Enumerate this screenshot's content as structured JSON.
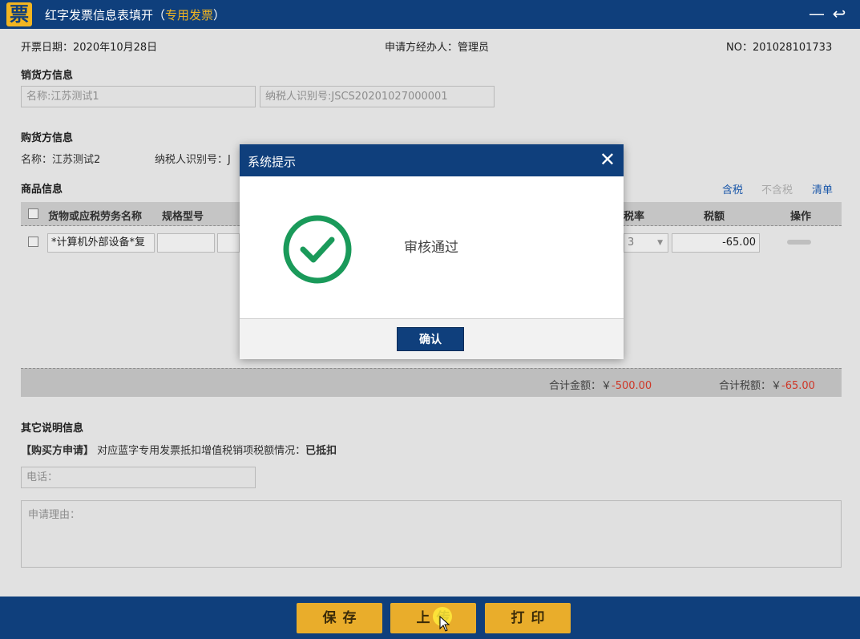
{
  "window": {
    "logo_char": "票",
    "title": "红字发票信息表填开（",
    "title_type": "专用发票",
    "title_close_paren": "）",
    "minimize_glyph": "—",
    "back_glyph": "↩"
  },
  "header": {
    "date": "开票日期：2020年10月28日",
    "applicant": "申请方经办人：管理员",
    "number": "NO：201028101733"
  },
  "seller": {
    "section_title": "销货方信息",
    "name": "名称:江苏测试1",
    "tax_id": "纳税人识别号:JSCS20201027000001"
  },
  "buyer": {
    "section_title": "购货方信息",
    "name": "名称：江苏测试2",
    "tax_id": "纳税人识别号：J"
  },
  "goods": {
    "section_title": "商品信息",
    "actions": {
      "tax_included": "含税",
      "tax_excluded": "不含税",
      "list": "清单"
    },
    "columns": {
      "name": "货物或应税劳务名称",
      "spec": "规格型号",
      "tax_rate": "税率",
      "tax_amount": "税额",
      "operation": "操作"
    },
    "rows": [
      {
        "name": "*计算机外部设备*复",
        "tax_rate": "3",
        "tax_amount": "-65.00"
      }
    ],
    "total_amount_label": "合计金额：￥",
    "total_amount": "-500.00",
    "total_tax_label": "合计税额：￥",
    "total_tax": "-65.00"
  },
  "other": {
    "section_title": "其它说明信息",
    "buyer_apply_tag": "【购买方申请】",
    "deduction_text": "对应蓝字专用发票抵扣增值税销项税额情况：",
    "deduction_status": "已抵扣",
    "phone_placeholder": "电话：",
    "reason_placeholder": "申请理由："
  },
  "footer": {
    "save": "保存",
    "upload": "上传",
    "print": "打印"
  },
  "dialog": {
    "title": "系统提示",
    "close_glyph": "✕",
    "message": "审核通过",
    "ok": "确认"
  },
  "colors": {
    "brand_blue": "#0f3f7c",
    "button_gold": "#e9ad2b",
    "success_green": "#1a9a5a",
    "negative_red": "#e03c2c"
  }
}
